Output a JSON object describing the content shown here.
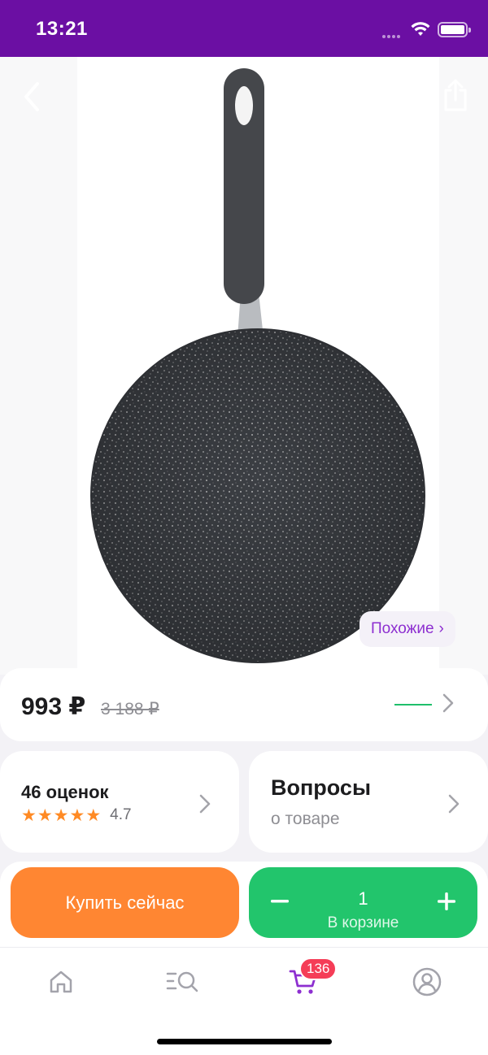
{
  "status_bar": {
    "time": "13:21"
  },
  "product": {
    "image_alt": "product-photo",
    "similar_label": "Похожие",
    "price_current": "993 ₽",
    "price_old": "3 188 ₽"
  },
  "rating": {
    "count_label": "46 оценок",
    "value": "4.7",
    "stars": 5
  },
  "questions": {
    "title": "Вопросы",
    "subtitle": "о товаре"
  },
  "actions": {
    "buy_now_label": "Купить сейчас",
    "cart_quantity": "1",
    "in_cart_label": "В корзине"
  },
  "tab_bar": {
    "cart_badge": "136"
  },
  "colors": {
    "brand_purple": "#6b0fa3",
    "buy_orange": "#ff8632",
    "cart_green": "#22c56c",
    "star_orange": "#ff8a24",
    "badge_red": "#f53d57"
  }
}
